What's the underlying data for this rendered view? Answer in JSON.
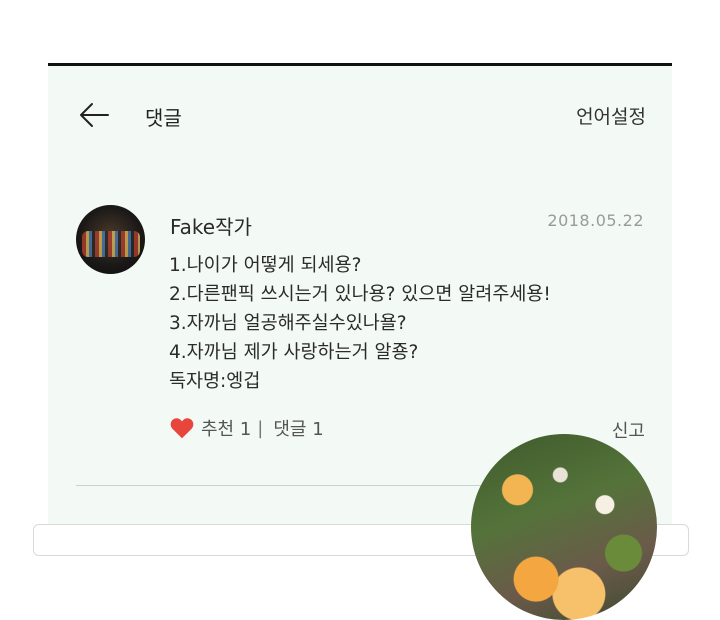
{
  "header": {
    "title": "댓글",
    "language_settings": "언어설정"
  },
  "comment": {
    "author": "Fake작가",
    "date": "2018.05.22",
    "lines": [
      "1.나이가 어떻게 되세용?",
      "2.다른팬픽 쓰시는거 있나용? 있으면 알려주세용!",
      "3.자까님 얼공해주실수있나욜?",
      "4.자까님 제가 사랑하는거 알죵?",
      "독자명:엥겁"
    ],
    "recommend_label": "추천 1",
    "reply_label": "댓글 1",
    "separator": "|",
    "report_label": "신고"
  },
  "colors": {
    "background": "#f3faf5",
    "heart": "#e8453c"
  },
  "icons": {
    "back": "back-arrow-icon",
    "like": "heart-icon"
  }
}
